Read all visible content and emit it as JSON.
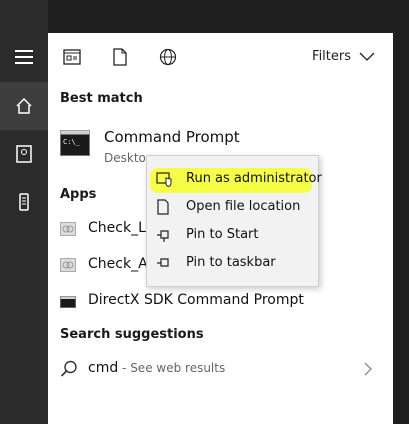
{
  "toolbar": {
    "filters_label": "Filters"
  },
  "sections": {
    "best_match": "Best match",
    "apps": "Apps",
    "search_suggestions": "Search suggestions"
  },
  "best_match": {
    "title": "Command Prompt",
    "subtitle": "Desktop"
  },
  "apps": [
    {
      "label": "Check_Lo"
    },
    {
      "label": "Check_Ac"
    },
    {
      "label": "DirectX SDK Command Prompt"
    }
  ],
  "suggestion": {
    "query": "cmd",
    "hint": " - See web results"
  },
  "context_menu": [
    {
      "label": "Run as administrator",
      "icon": "shield-admin-icon"
    },
    {
      "label": "Open file location",
      "icon": "file-icon"
    },
    {
      "label": "Pin to Start",
      "icon": "pin-icon"
    },
    {
      "label": "Pin to taskbar",
      "icon": "pin-icon"
    }
  ],
  "colors": {
    "highlight": "#f6ff3b",
    "rail": "#2b2b2b",
    "panel": "#ffffff"
  }
}
